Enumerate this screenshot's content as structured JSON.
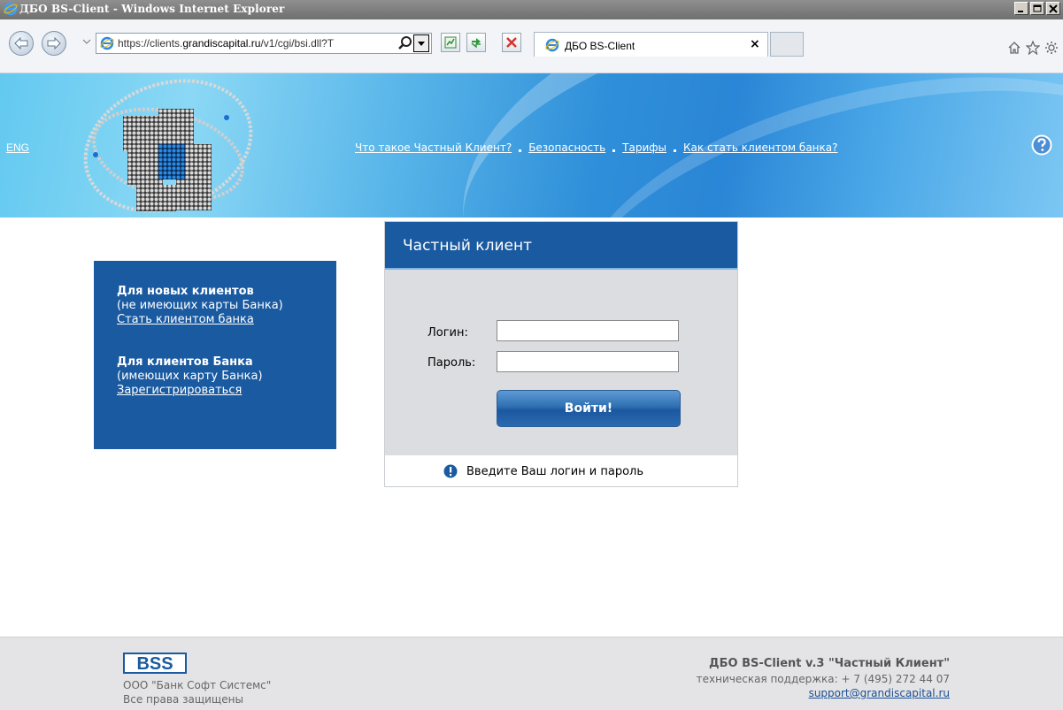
{
  "window": {
    "title": "ДБО BS-Client - Windows Internet Explorer"
  },
  "browser": {
    "url_prefix": "https://clients.",
    "url_host": "grandiscapital.ru",
    "url_suffix": "/v1/cgi/bsi.dll?T",
    "tab_label": "ДБО BS-Client",
    "tab_close": "×"
  },
  "header": {
    "lang_link": "ENG",
    "nav": [
      "Что такое Частный Клиент?",
      "Безопасность",
      "Тарифы",
      "Как стать клиентом банка?"
    ]
  },
  "infobox": {
    "new_clients_title": "Для новых клиентов",
    "new_clients_note": "(не имеющих карты Банка)",
    "new_clients_link": "Стать клиентом банка",
    "bank_clients_title": "Для клиентов Банка",
    "bank_clients_note": "(имеющих карту Банка)",
    "bank_clients_link": "Зарегистрироваться"
  },
  "login": {
    "title": "Частный клиент",
    "login_label": "Логин:",
    "login_value": "",
    "password_label": "Пароль:",
    "password_value": "",
    "submit_label": "Войти!",
    "hint": "Введите Ваш логин и пароль"
  },
  "footer": {
    "company": "ООО \"Банк Софт Системс\"",
    "rights": "Все права защищены",
    "product": "ДБО BS-Client v.3 \"Частный Клиент\"",
    "support_phone": "техническая поддержка: + 7 (495) 272 44 07",
    "support_email": "support@grandiscapital.ru",
    "logo_text": "BSS"
  },
  "colors": {
    "brand_blue": "#1a5aa0",
    "footer_bg": "#e4e4e6",
    "panel_bg": "#dcdde0"
  },
  "icons": [
    "ie-icon",
    "back-arrow-icon",
    "forward-arrow-icon",
    "search-icon",
    "compat-view-icon",
    "refresh-icon",
    "stop-icon",
    "home-icon",
    "favorites-star-icon",
    "tools-gear-icon",
    "help-icon",
    "info-icon"
  ]
}
